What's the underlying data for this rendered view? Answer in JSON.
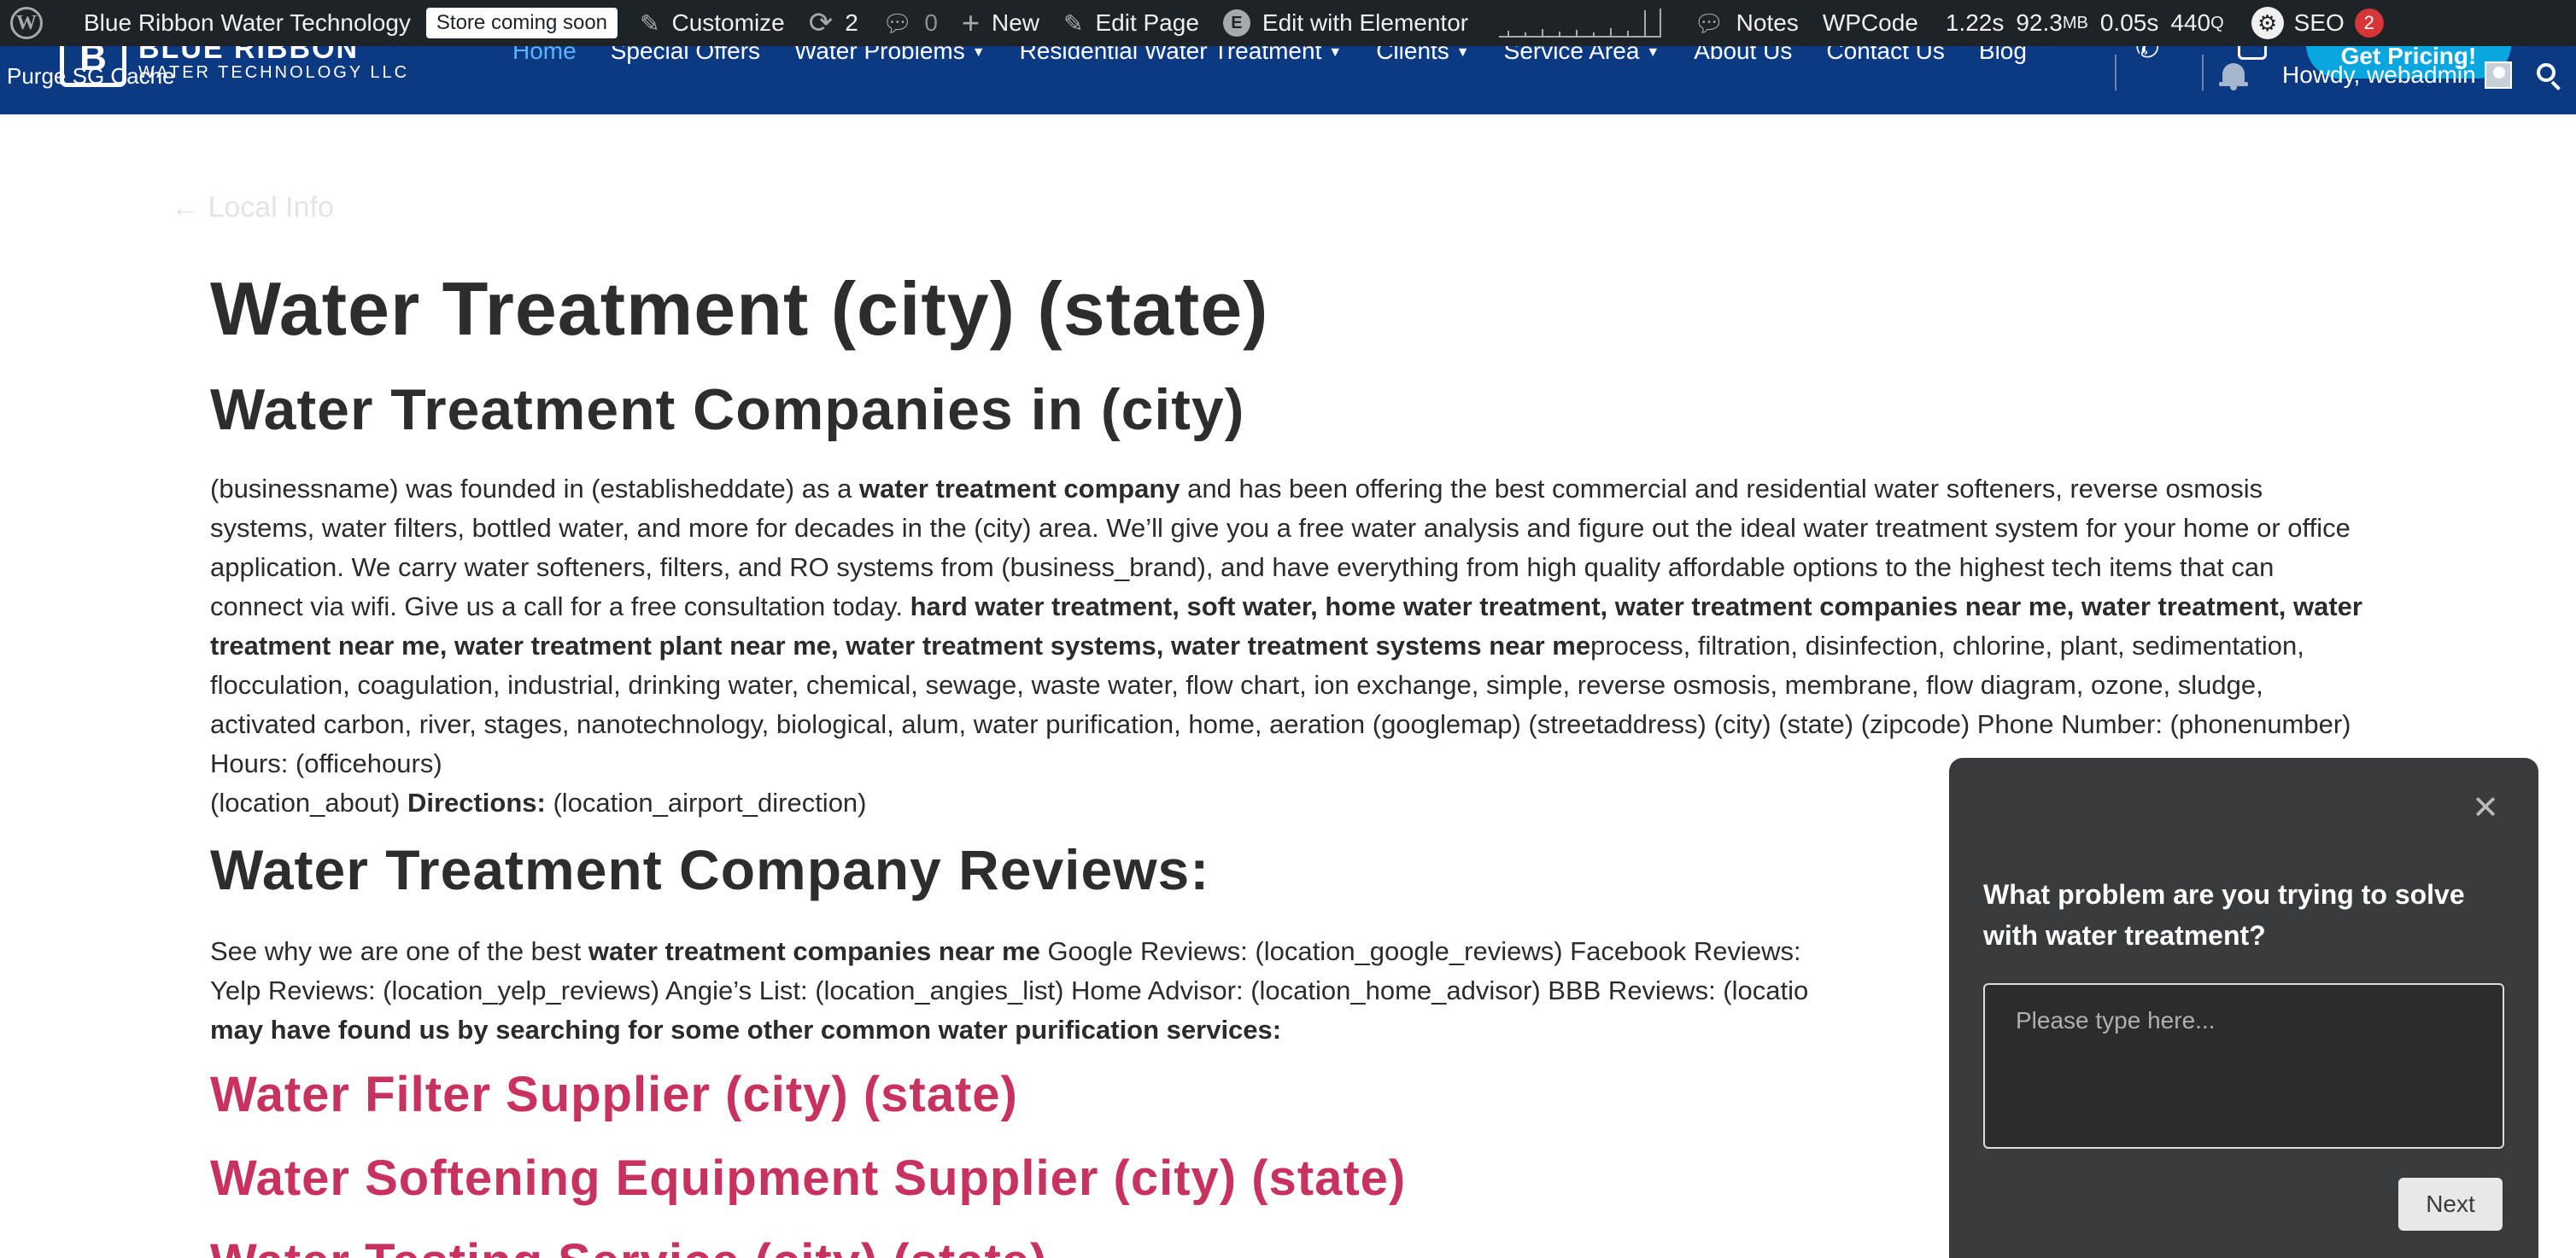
{
  "admin_bar": {
    "site_name": "Blue Ribbon Water Technology",
    "store_status": "Store coming soon",
    "customize": "Customize",
    "updates_count": "2",
    "comments_count": "0",
    "new_label": "New",
    "edit_page": "Edit Page",
    "edit_elementor": "Edit with Elementor",
    "notes": "Notes",
    "wpcode": "WPCode",
    "perf_time": "1.22s",
    "perf_memory": "92.3",
    "perf_memory_unit": "MB",
    "perf_query_time": "0.05s",
    "perf_queries": "440",
    "perf_queries_unit": "Q",
    "seo_label": "SEO",
    "seo_count": "2"
  },
  "header": {
    "logo_main": "BLUE RIBBON",
    "logo_sub": "WATER TECHNOLOGY LLC",
    "logo_mark": "B",
    "purge_cache": "Purge SG Cache",
    "nav": [
      {
        "label": "Home",
        "active": true
      },
      {
        "label": "Special Offers"
      },
      {
        "label": "Water Problems",
        "has_caret": true
      },
      {
        "label": "Residential Water Treatment",
        "has_caret": true
      },
      {
        "label": "Clients",
        "has_caret": true
      },
      {
        "label": "Service Area",
        "has_caret": true
      },
      {
        "label": "About Us"
      },
      {
        "label": "Contact Us"
      },
      {
        "label": "Blog"
      }
    ],
    "cta_label": "Get Pricing!",
    "howdy": "Howdy, webadmin"
  },
  "breadcrumb": "← Local Info",
  "main": {
    "title": "Water Treatment (city) (state)",
    "subtitle": "Water Treatment Companies in (city)",
    "para1": {
      "p1": "(businessname) was founded in (establisheddate) as a ",
      "b1": "water treatment company",
      "p2": " and has been offering the best commercial and residential water softeners, reverse osmosis systems, water filters, bottled water, and more for decades in the (city) area. We’ll give you a free water analysis and figure out the ideal water treatment system for your home or office application. We carry water softeners, filters, and RO systems from (business_brand), and have everything from high quality affordable options to the highest tech items that can connect via wifi. Give us a call for a free consultation today. ",
      "b2": "hard water treatment, soft water, home water treatment, water treatment companies near me, water treatment, water treatment near me, water treatment plant near me, water treatment systems, water treatment systems near me",
      "p3": "process, filtration, disinfection, chlorine, plant, sedimentation, flocculation, coagulation, industrial, drinking water, chemical, sewage, waste water, flow chart, ion exchange, simple, reverse osmosis, membrane, flow diagram, ozone, sludge, activated carbon, river, stages, nanotechnology, biological, alum, water purification, home, aeration (googlemap) (streetaddress) (city) (state) (zipcode) Phone Number: (phonenumber) Hours: (officehours)",
      "p4": "(location_about) ",
      "b3": "Directions:",
      "p5": " (location_airport_direction)"
    },
    "reviews_title": "Water Treatment Company Reviews:",
    "para2": {
      "p1": "See why we are one of the best ",
      "b1": "water treatment companies near me",
      "p2": " Google Reviews: (location_google_reviews) Facebook Reviews: ",
      "p3": "Yelp Reviews: (location_yelp_reviews) Angie’s List: (location_angies_list) Home Advisor: (location_home_advisor) BBB Reviews: (locatio",
      "b2": "may have found us by searching for some other common water purification services:"
    },
    "services": [
      "Water Filter Supplier (city) (state)",
      "Water Softening Equipment Supplier (city) (state)",
      "Water Testing Service (city) (state)"
    ]
  },
  "popup": {
    "question": "What problem are you trying to solve with water treatment?",
    "placeholder": "Please type here...",
    "next_label": "Next"
  },
  "colors": {
    "admin_bar_bg": "#1d2327",
    "header_bg": "#0b3a82",
    "accent_link": "#c8325e",
    "popup_bg": "#3a3b3c"
  }
}
